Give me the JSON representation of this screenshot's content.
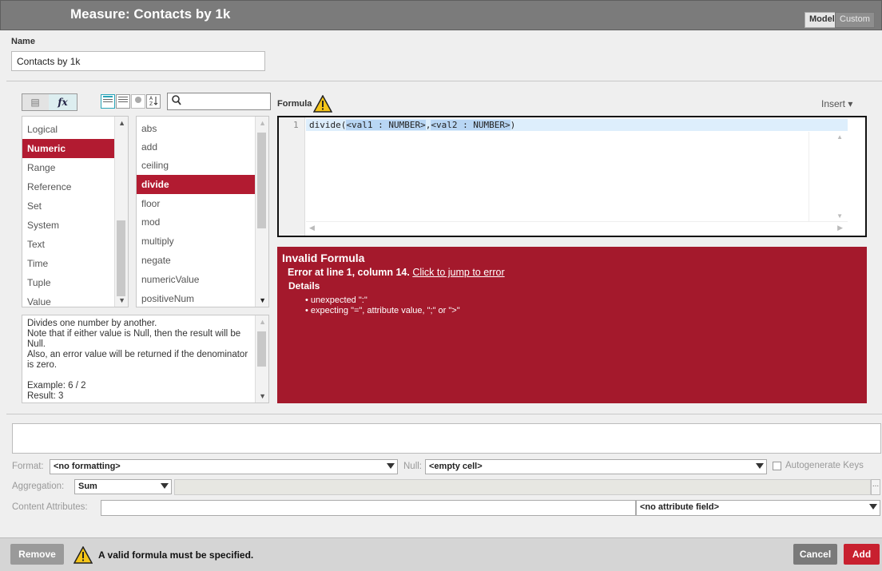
{
  "header": {
    "title": "Measure: Contacts by 1k",
    "toggle_model": "Model",
    "toggle_custom": "Custom"
  },
  "name": {
    "label": "Name",
    "value": "Contacts by 1k"
  },
  "toolbar": {
    "mode_db": "▤",
    "mode_fx": "fx",
    "sort_icon": "A↓Z"
  },
  "formula": {
    "label": "Formula",
    "insert_label": "Insert ▾"
  },
  "categories": {
    "items": [
      "Logical",
      "Numeric",
      "Range",
      "Reference",
      "Set",
      "System",
      "Text",
      "Time",
      "Tuple",
      "Value"
    ],
    "selected": "Numeric"
  },
  "functions": {
    "items": [
      "abs",
      "add",
      "ceiling",
      "divide",
      "floor",
      "mod",
      "multiply",
      "negate",
      "numericValue",
      "positiveNum"
    ],
    "selected": "divide"
  },
  "description": "Divides one number by another.\nNote that if either value is Null, then the result will be Null.\nAlso, an error value will be returned if the denominator is zero.\n\nExample: 6 / 2\nResult: 3",
  "editor": {
    "line_number": "1",
    "code_prefix": "divide(",
    "code_param1": "<val1 : NUMBER>",
    "code_sep": ",",
    "code_param2": "<val2 : NUMBER>",
    "code_suffix": ")"
  },
  "error": {
    "title": "Invalid Formula",
    "line": "Error at line 1, column 14.",
    "link": "Click to jump to error",
    "details_label": "Details",
    "bullets": [
      "unexpected \":\"",
      "expecting \"=\", attribute value, \";\" or \">\""
    ]
  },
  "form": {
    "format_label": "Format:",
    "format_value": "<no formatting>",
    "null_label": "Null:",
    "null_value": "<empty cell>",
    "autogen_label": "Autogenerate Keys",
    "aggregation_label": "Aggregation:",
    "aggregation_value": "Sum",
    "ellipsis": "...",
    "content_label": "Content Attributes:",
    "attribute_value": "<no attribute field>"
  },
  "footer": {
    "remove_label": "Remove",
    "message": "A valid formula must be specified.",
    "cancel_label": "Cancel",
    "add_label": "Add"
  },
  "colors": {
    "accent": "#b21b31",
    "error_bg": "#a4192c",
    "header_bg": "#7b7b7b",
    "teal": "#2aa4b8"
  }
}
